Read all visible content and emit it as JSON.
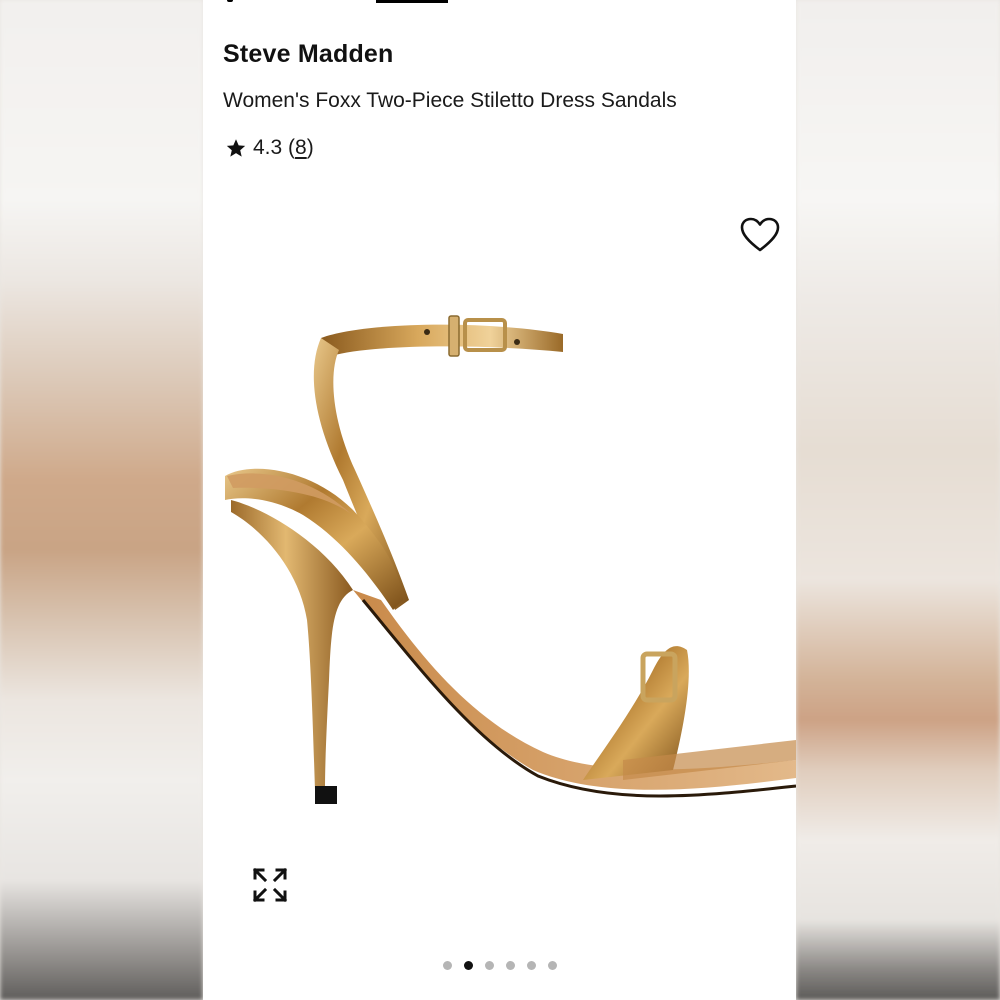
{
  "product": {
    "brand": "Steve Madden",
    "name": "Women's Foxx Two-Piece Stiletto Dress Sandals",
    "rating": "4.3",
    "review_count": "8"
  },
  "icons": {
    "rating": "star-icon",
    "favorite": "heart-icon",
    "zoom": "expand-icon"
  },
  "gallery": {
    "total_images": 6,
    "active_index": 1
  },
  "colors": {
    "text": "#111111",
    "dot_inactive": "#b5b5b5",
    "dot_active": "#111111",
    "product_gold": "#b8863b"
  }
}
